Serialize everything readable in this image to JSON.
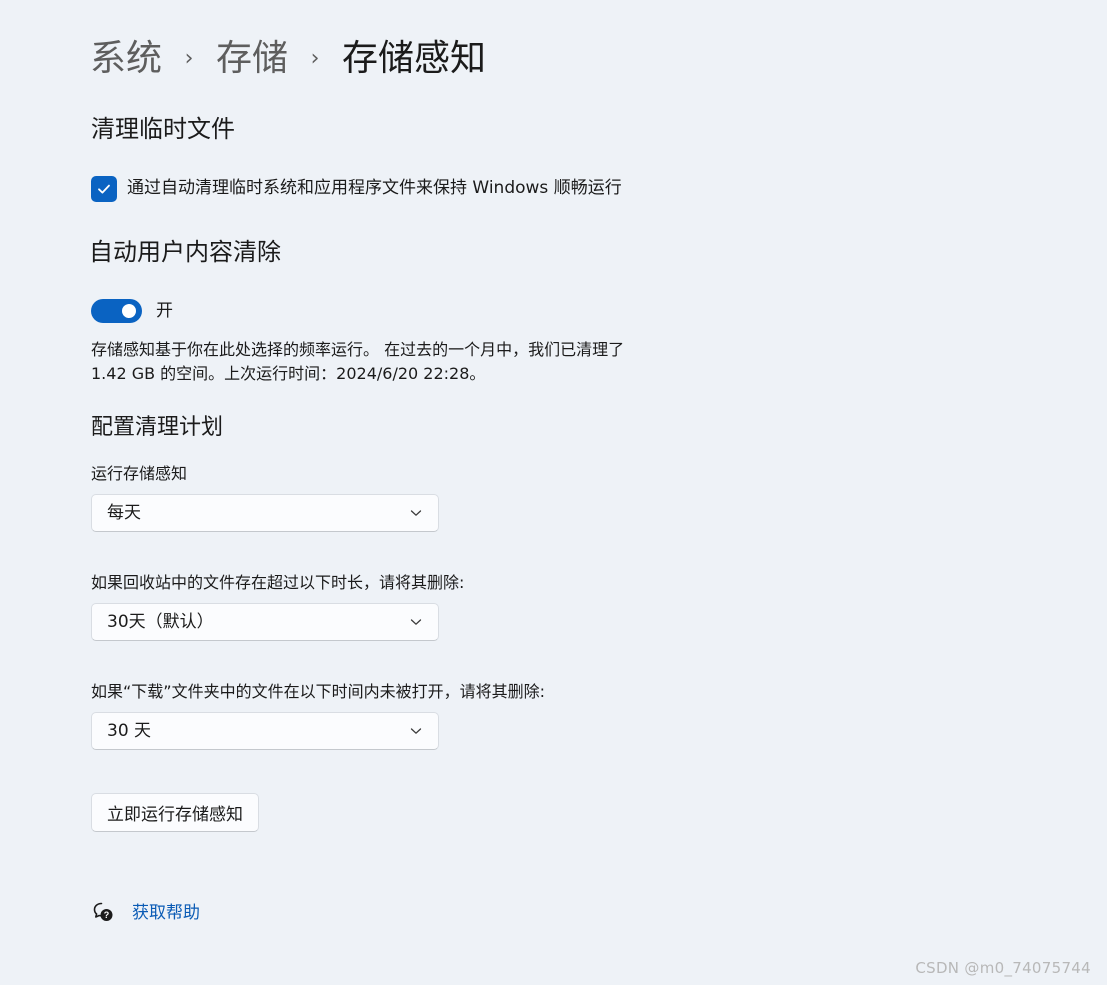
{
  "breadcrumb": {
    "items": [
      "系统",
      "存储"
    ],
    "current": "存储感知",
    "separator": "›"
  },
  "temp_files": {
    "title": "清理临时文件",
    "checkbox_label": "通过自动清理临时系统和应用程序文件来保持 Windows 顺畅运行",
    "checked": true
  },
  "auto_cleanup": {
    "title": "自动用户内容清除",
    "toggle_label": "开",
    "toggle_on": true,
    "description": "存储感知基于你在此处选择的频率运行。 在过去的一个月中，我们已清理了 1.42 GB 的空间。上次运行时间：2024/6/20 22:28。"
  },
  "schedule": {
    "title": "配置清理计划",
    "run_label": "运行存储感知",
    "run_value": "每天",
    "recycle_label": "如果回收站中的文件存在超过以下时长，请将其删除:",
    "recycle_value": "30天（默认）",
    "downloads_label": "如果“下载”文件夹中的文件在以下时间内未被打开，请将其删除:",
    "downloads_value": "30 天"
  },
  "actions": {
    "run_now_label": "立即运行存储感知",
    "help_label": "获取帮助"
  },
  "watermark": "CSDN @m0_74075744",
  "colors": {
    "accent": "#0a63c2",
    "background": "#eef2f7",
    "link": "#0a5bb5"
  },
  "icons": {
    "checkbox": "checkmark-icon",
    "dropdown": "chevron-down-icon",
    "help": "help-chat-icon"
  }
}
